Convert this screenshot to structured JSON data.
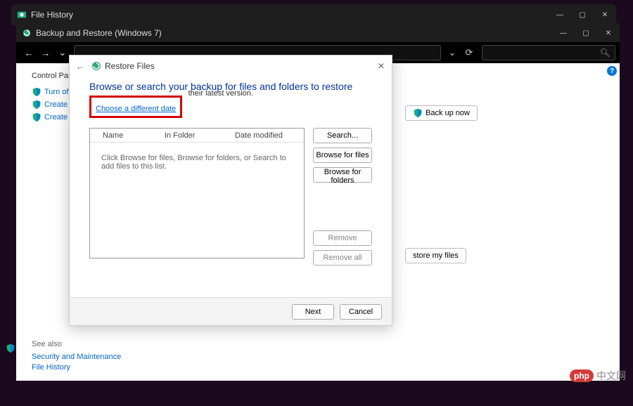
{
  "win1": {
    "title": "File History"
  },
  "win2": {
    "title": "Backup and Restore (Windows 7)"
  },
  "cp": {
    "heading": "Control Panel",
    "links": [
      "Turn off sche",
      "Create a syste",
      "Create a syste"
    ],
    "backup_now": "Back up now",
    "restore_my": "store my files",
    "see_also": "See also",
    "see_links": [
      "Security and Maintenance",
      "File History"
    ]
  },
  "dlg": {
    "title": "Restore Files",
    "h1": "Browse or search your backup for files and folders to restore",
    "sub": "their latest version.",
    "choose": "Choose a different date",
    "cols": {
      "name": "Name",
      "folder": "In Folder",
      "date": "Date modified"
    },
    "empty": "Click Browse for files, Browse for folders, or Search to add files to this list.",
    "btn_search": "Search...",
    "btn_browse_files": "Browse for files",
    "btn_browse_folders": "Browse for folders",
    "btn_remove": "Remove",
    "btn_remove_all": "Remove all",
    "next": "Next",
    "cancel": "Cancel"
  },
  "watermark": {
    "badge": "php",
    "text": "中文网"
  }
}
